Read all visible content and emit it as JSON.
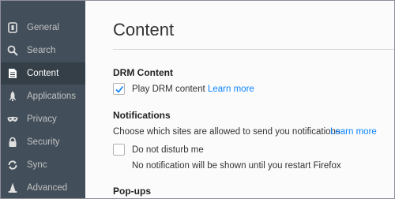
{
  "sidebar": {
    "items": [
      {
        "label": "General",
        "icon": "general-icon",
        "selected": false
      },
      {
        "label": "Search",
        "icon": "search-icon",
        "selected": false
      },
      {
        "label": "Content",
        "icon": "content-icon",
        "selected": true
      },
      {
        "label": "Applications",
        "icon": "rocket-icon",
        "selected": false
      },
      {
        "label": "Privacy",
        "icon": "mask-icon",
        "selected": false
      },
      {
        "label": "Security",
        "icon": "lock-icon",
        "selected": false
      },
      {
        "label": "Sync",
        "icon": "sync-icon",
        "selected": false
      },
      {
        "label": "Advanced",
        "icon": "wizard-hat-icon",
        "selected": false
      }
    ]
  },
  "main": {
    "title": "Content",
    "drm": {
      "heading": "DRM Content",
      "checkbox_label": "Play DRM content",
      "checked": true,
      "learn_more": "Learn more"
    },
    "notifications": {
      "heading": "Notifications",
      "description": "Choose which sites are allowed to send you notifications",
      "learn_more": "Learn more",
      "dnd_label": "Do not disturb me",
      "dnd_checked": false,
      "dnd_note": "No notification will be shown until you restart Firefox"
    },
    "popups": {
      "heading": "Pop-ups"
    }
  },
  "colors": {
    "sidebar_bg": "#424f5a",
    "sidebar_selected_bg": "#343f48",
    "link": "#0a84ff",
    "check": "#0a84ff"
  }
}
